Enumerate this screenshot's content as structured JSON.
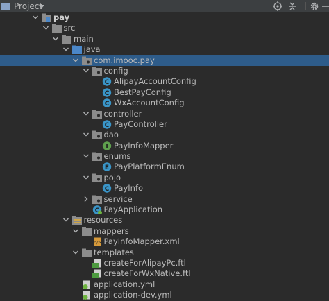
{
  "toolbar": {
    "project_label": "Project",
    "icons": [
      "locate-icon",
      "collapse-icon",
      "settings-icon",
      "minimize-icon"
    ]
  },
  "tree": [
    {
      "label": "pay",
      "depth": 0,
      "expanded": true,
      "icon": "module-folder-icon",
      "bold": true
    },
    {
      "label": "src",
      "depth": 1,
      "expanded": true,
      "icon": "folder-icon"
    },
    {
      "label": "main",
      "depth": 2,
      "expanded": true,
      "icon": "folder-icon"
    },
    {
      "label": "java",
      "depth": 3,
      "expanded": true,
      "icon": "source-folder-icon"
    },
    {
      "label": "com.imooc.pay",
      "depth": 4,
      "expanded": true,
      "icon": "package-icon",
      "selected": true
    },
    {
      "label": "config",
      "depth": 5,
      "expanded": true,
      "icon": "package-icon"
    },
    {
      "label": "AlipayAccountConfig",
      "depth": 6,
      "icon": "class-icon"
    },
    {
      "label": "BestPayConfig",
      "depth": 6,
      "icon": "class-icon"
    },
    {
      "label": "WxAccountConfig",
      "depth": 6,
      "icon": "class-icon"
    },
    {
      "label": "controller",
      "depth": 5,
      "expanded": true,
      "icon": "package-icon"
    },
    {
      "label": "PayController",
      "depth": 6,
      "icon": "class-icon"
    },
    {
      "label": "dao",
      "depth": 5,
      "expanded": true,
      "icon": "package-icon"
    },
    {
      "label": "PayInfoMapper",
      "depth": 6,
      "icon": "interface-icon"
    },
    {
      "label": "enums",
      "depth": 5,
      "expanded": true,
      "icon": "package-icon"
    },
    {
      "label": "PayPlatformEnum",
      "depth": 6,
      "icon": "enum-icon"
    },
    {
      "label": "pojo",
      "depth": 5,
      "expanded": true,
      "icon": "package-icon"
    },
    {
      "label": "PayInfo",
      "depth": 6,
      "icon": "class-icon"
    },
    {
      "label": "service",
      "depth": 5,
      "expanded": false,
      "icon": "package-icon"
    },
    {
      "label": "PayApplication",
      "depth": 5,
      "icon": "spring-app-icon"
    },
    {
      "label": "resources",
      "depth": 3,
      "expanded": true,
      "icon": "resources-folder-icon"
    },
    {
      "label": "mappers",
      "depth": 4,
      "expanded": true,
      "icon": "folder-icon"
    },
    {
      "label": "PayInfoMapper.xml",
      "depth": 5,
      "icon": "xml-file-icon"
    },
    {
      "label": "templates",
      "depth": 4,
      "expanded": true,
      "icon": "folder-icon"
    },
    {
      "label": "createForAlipayPc.ftl",
      "depth": 5,
      "icon": "ftl-file-icon"
    },
    {
      "label": "createForWxNative.ftl",
      "depth": 5,
      "icon": "ftl-file-icon"
    },
    {
      "label": "application.yml",
      "depth": 4,
      "icon": "yml-file-icon"
    },
    {
      "label": "application-dev.yml",
      "depth": 4,
      "icon": "yml-file-icon"
    }
  ]
}
